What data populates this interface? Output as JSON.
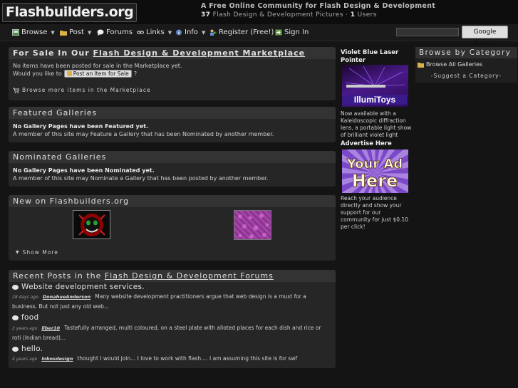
{
  "header": {
    "logo_text": "Flashbuilders.org",
    "tagline": "A Free Online Community for Flash Design & Development",
    "pictures_count": "37",
    "pictures_label": "Flash Design & Development Pictures · ",
    "users_count": "1",
    "users_label": "Users"
  },
  "nav": {
    "items": [
      {
        "label": "Browse",
        "icon": "browse-icon",
        "has_caret": true
      },
      {
        "label": "Post",
        "icon": "folder-icon",
        "has_caret": true
      },
      {
        "label": "Forums",
        "icon": "speech-bubble-icon",
        "has_caret": false
      },
      {
        "label": "Links",
        "icon": "link-icon",
        "has_caret": true
      },
      {
        "label": "Info",
        "icon": "info-icon",
        "has_caret": true
      },
      {
        "label": "Register (Free!)",
        "icon": "register-icon",
        "has_caret": false
      },
      {
        "label": "Sign In",
        "icon": "sign-in-icon",
        "has_caret": false
      }
    ],
    "search_placeholder": "",
    "search_button": "Google Search"
  },
  "marketplace": {
    "title_prefix": "For Sale In Our ",
    "title_link": "Flash Design & Development Marketplace",
    "empty_text": "No items have been posted for sale in the Marketplace yet.",
    "prompt_text": "Would you like to",
    "post_button": "Post an Item for Sale",
    "prompt_end": "?",
    "browse_more": "Browse more items in the Marketplace"
  },
  "featured": {
    "title": "Featured Galleries",
    "bold_text": "No Gallery Pages have been Featured yet.",
    "text": "A member of this site may Feature a Gallery that has been Nominated by another member."
  },
  "nominated": {
    "title": "Nominated Galleries",
    "bold_text": "No Gallery Pages have been Nominated yet.",
    "text": "A member of this site may Nominate a Gallery that has been posted by another member."
  },
  "new_on": {
    "title": "New on Flashbuilders.org",
    "thumbnails": [
      "red-face-thumbnail",
      "purple-pattern-thumbnail"
    ],
    "show_more": "Show More"
  },
  "recent_posts": {
    "title_prefix": "Recent Posts in the ",
    "title_link": "Flash Design & Development Forums",
    "posts": [
      {
        "title": "Website development services.",
        "age": "28 days ago",
        "user": "DonahueAnderson",
        "excerpt": "Many website development practitioners argue that web design is a must for a business. But not just any old web..."
      },
      {
        "title": "food",
        "age": "2 years ago",
        "user": "liber10",
        "excerpt": "Tastefully arranged, multi coloured, on a steel plate with alloted places for each dish and rice or roti (Indian bread)..."
      },
      {
        "title": "hello.",
        "age": "4 years ago",
        "user": "lobosdesign",
        "excerpt": "thought I would join... I love to work with flash.... I am assuming this site is for swf"
      }
    ]
  },
  "ads": {
    "ad1_title": "Violet Blue Laser Pointer",
    "ad1_image_label": "IllumiToys",
    "ad1_text": "Now available with a Kaleidoscopic diffraction lens, a portable light show of brilliant violet light",
    "ad2_title": "Advertise Here",
    "ad2_image_line1": "Your Ad",
    "ad2_image_line2": "Here",
    "ad2_text": "Reach your audience directly and show your support for our community for just $0.10 per click!"
  },
  "categories": {
    "title": "Browse by Category",
    "browse_all": "Browse All Galleries",
    "suggest": "-Suggest a Category-"
  },
  "colors": {
    "background": "#141414",
    "panel": "#262626",
    "panel_header": "#333333",
    "accent_green": "#3d8f3d"
  }
}
